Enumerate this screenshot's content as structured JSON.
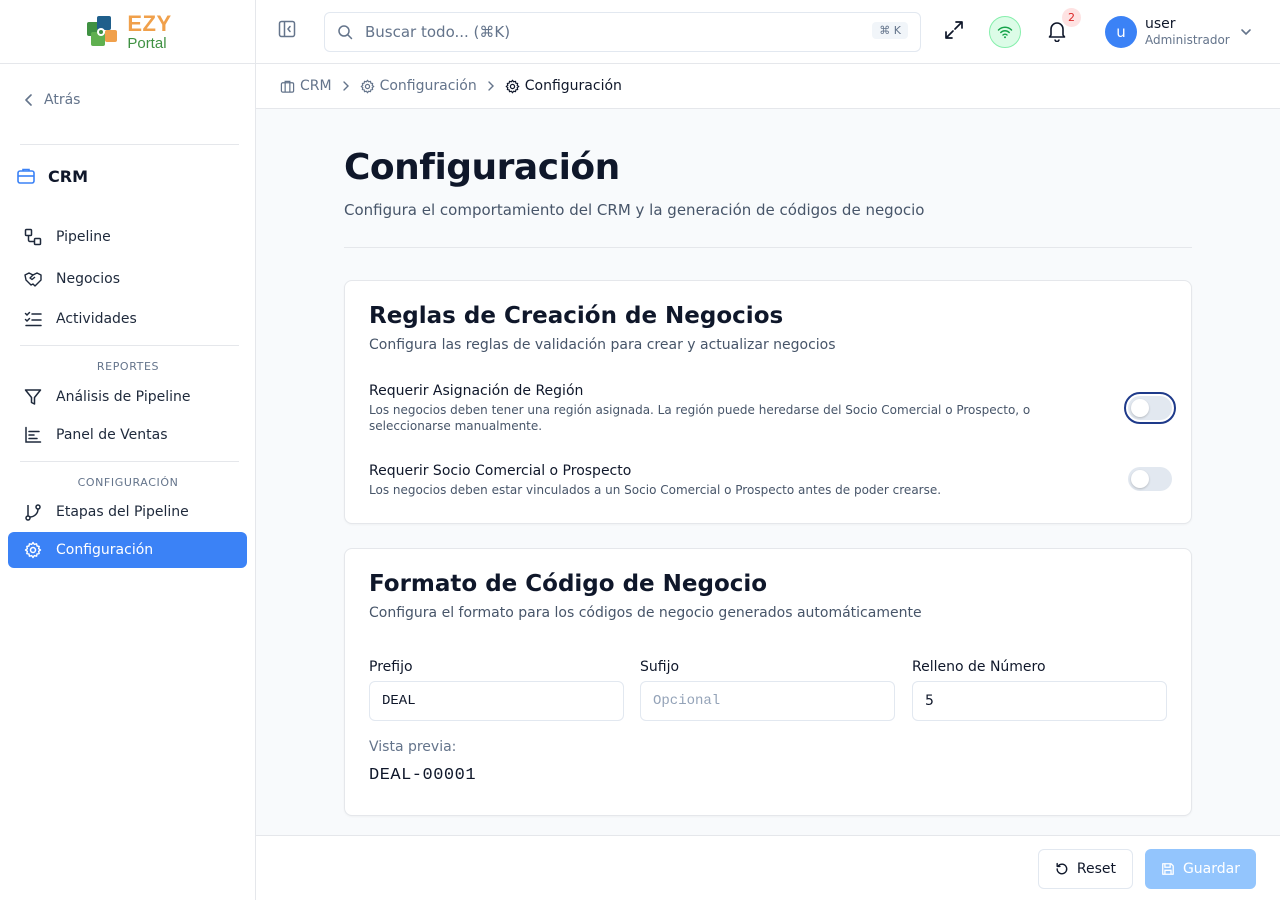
{
  "brand": {
    "name_top": "EZY",
    "name_bottom": "Portal",
    "orange": "#f0a04b",
    "green": "#3f9142"
  },
  "sidebar": {
    "back_label": "Atrás",
    "module_title": "CRM",
    "items": [
      {
        "label": "Pipeline",
        "icon": "workflow-icon"
      },
      {
        "label": "Negocios",
        "icon": "handshake-icon"
      },
      {
        "label": "Actividades",
        "icon": "checklist-icon"
      }
    ],
    "reports_label": "REPORTES",
    "report_items": [
      {
        "label": "Análisis de Pipeline",
        "icon": "funnel-icon"
      },
      {
        "label": "Panel de Ventas",
        "icon": "chart-icon"
      }
    ],
    "config_label": "CONFIGURACIÓN",
    "config_items": [
      {
        "label": "Etapas del Pipeline",
        "icon": "git-branch-icon"
      },
      {
        "label": "Configuración",
        "icon": "gear-icon",
        "active": true
      }
    ]
  },
  "topbar": {
    "search_placeholder": "Buscar todo... (⌘K)",
    "shortcut": "⌘ K",
    "notification_count": "2",
    "user_initial": "u",
    "user_name": "user",
    "user_role": "Administrador"
  },
  "breadcrumb": [
    "CRM",
    "Configuración",
    "Configuración"
  ],
  "page": {
    "title": "Configuración",
    "subtitle": "Configura el comportamiento del CRM y la generación de códigos de negocio"
  },
  "rules_card": {
    "title": "Reglas de Creación de Negocios",
    "subtitle": "Configura las reglas de validación para crear y actualizar negocios",
    "settings": [
      {
        "label": "Requerir Asignación de Región",
        "description": "Los negocios deben tener una región asignada. La región puede heredarse del Socio Comercial o Prospecto, o seleccionarse manualmente.",
        "enabled": false
      },
      {
        "label": "Requerir Socio Comercial o Prospecto",
        "description": "Los negocios deben estar vinculados a un Socio Comercial o Prospecto antes de poder crearse.",
        "enabled": false
      }
    ]
  },
  "format_card": {
    "title": "Formato de Código de Negocio",
    "subtitle": "Configura el formato para los códigos de negocio generados automáticamente",
    "prefix_label": "Prefijo",
    "prefix_value": "DEAL",
    "suffix_label": "Sufijo",
    "suffix_placeholder": "Opcional",
    "padding_label": "Relleno de Número",
    "padding_value": "5",
    "preview_label": "Vista previa:",
    "preview_value": "DEAL-00001"
  },
  "footer": {
    "reset_label": "Reset",
    "save_label": "Guardar"
  }
}
